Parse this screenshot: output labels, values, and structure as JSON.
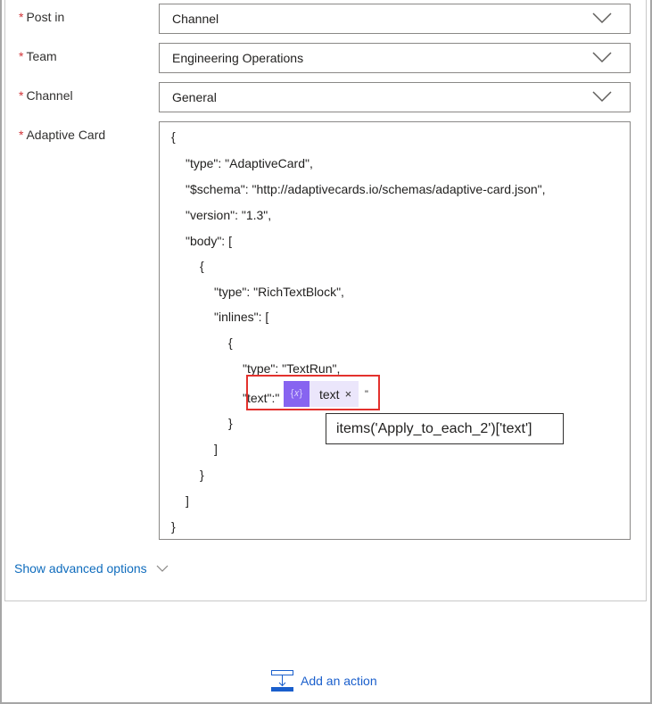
{
  "fields": [
    {
      "label": "Post in",
      "value": "Channel",
      "required": "*"
    },
    {
      "label": "Team",
      "value": "Engineering Operations",
      "required": "*"
    },
    {
      "label": "Channel",
      "value": "General",
      "required": "*"
    }
  ],
  "adaptive_card": {
    "label": "Adaptive Card",
    "required": "*",
    "lines": [
      "{",
      "\"type\": \"AdaptiveCard\",",
      "\"$schema\": \"http://adaptivecards.io/schemas/adaptive-card.json\",",
      "\"version\": \"1.3\",",
      "\"body\": [",
      "{",
      "\"type\": \"RichTextBlock\",",
      "\"inlines\": [",
      "{",
      "\"type\": \"TextRun\",",
      "\"text\":\"",
      "}",
      "]",
      "}",
      "]",
      "}"
    ],
    "token_label": "text",
    "token_close": "×",
    "token_suffix": "\"",
    "token_icon": "{𝑥}",
    "tooltip": "items('Apply_to_each_2')['text']"
  },
  "show_advanced": "Show advanced options",
  "add_action": "Add an action",
  "colors": {
    "accent": "#0f6cbd",
    "token": "#8764f0",
    "highlight": "#e3312d",
    "required": "#d13438"
  }
}
